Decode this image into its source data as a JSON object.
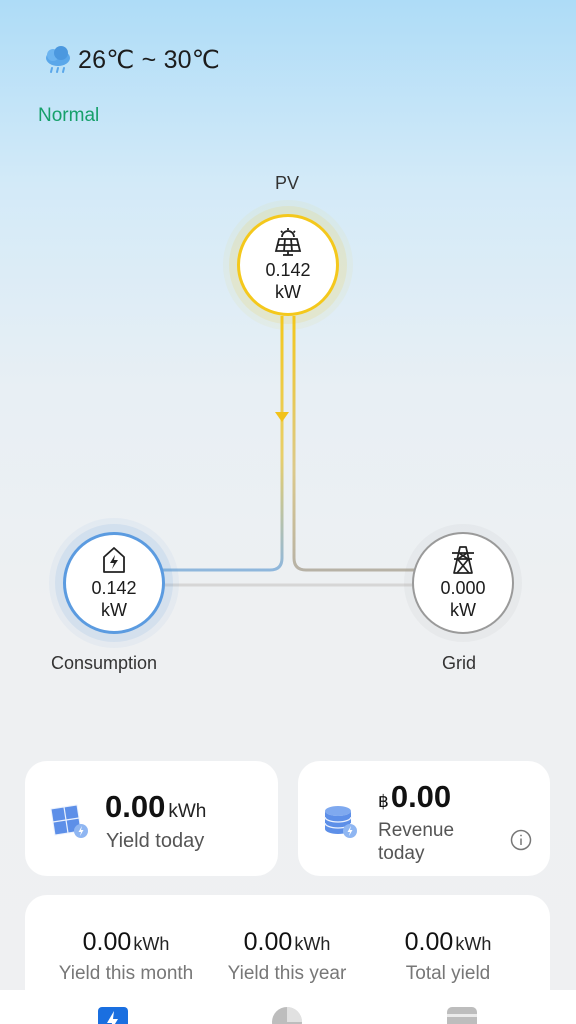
{
  "weather": {
    "icon": "cloud-rain-icon",
    "temperature": "26℃ ~ 30℃"
  },
  "status": {
    "text": "Normal",
    "color": "#16a06a"
  },
  "flow": {
    "pv": {
      "label": "PV",
      "value": "0.142",
      "unit": "kW",
      "icon": "solar-panel-icon",
      "color": "#f4c81c"
    },
    "consumption": {
      "label": "Consumption",
      "value": "0.142",
      "unit": "kW",
      "icon": "home-power-icon",
      "color": "#5b9be0"
    },
    "grid": {
      "label": "Grid",
      "value": "0.000",
      "unit": "kW",
      "icon": "power-tower-icon",
      "color": "#9a9a9a"
    }
  },
  "cards": {
    "yield_today": {
      "value": "0.00",
      "unit": "kWh",
      "label": "Yield today",
      "icon": "solar-panel-icon"
    },
    "revenue_today": {
      "currency": "฿",
      "value": "0.00",
      "label": "Revenue today",
      "icon": "coins-icon",
      "info_icon": "info-icon"
    }
  },
  "stats": {
    "month": {
      "value": "0.00",
      "unit": "kWh",
      "label": "Yield this month"
    },
    "year": {
      "value": "0.00",
      "unit": "kWh",
      "label": "Yield this year"
    },
    "total": {
      "value": "0.00",
      "unit": "kWh",
      "label": "Total yield"
    }
  },
  "tabbar": {
    "tabs": [
      {
        "icon": "lightning-icon",
        "active": true,
        "color": "#1a6fe0"
      },
      {
        "icon": "pie-chart-icon",
        "active": false,
        "color": "#b8b8b8"
      },
      {
        "icon": "device-icon",
        "active": false,
        "color": "#b8b8b8"
      }
    ]
  }
}
